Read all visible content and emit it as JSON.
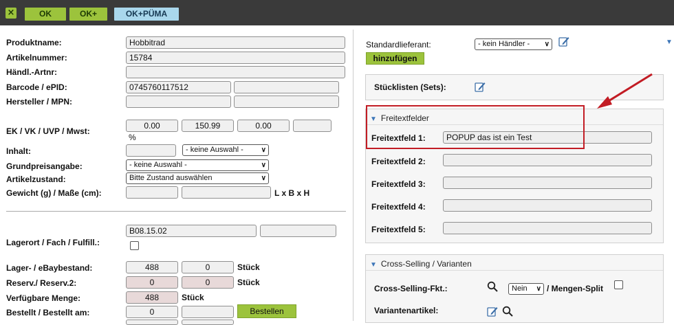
{
  "toolbar": {
    "close_icon": "×",
    "ok": "OK",
    "ok_plus": "OK+",
    "ok_puma": "OK+PÜMA"
  },
  "left": {
    "produktname": {
      "label": "Produktname:",
      "value": "Hobbitrad"
    },
    "artikelnummer": {
      "label": "Artikelnummer:",
      "value": "15784"
    },
    "haendl_artnr": {
      "label": "Händl.-Artnr:",
      "value": ""
    },
    "barcode": {
      "label": "Barcode / ePID:",
      "value": "0745760117512",
      "value2": ""
    },
    "hersteller": {
      "label": "Hersteller / MPN:",
      "value": "",
      "value2": ""
    },
    "ek_vk": {
      "label": "EK / VK / UVP / Mwst:",
      "ek": "0.00",
      "vk": "150.99",
      "uvp": "0.00",
      "mwst": "",
      "percent": "%"
    },
    "inhalt": {
      "label": "Inhalt:",
      "value": "",
      "select": "- keine Auswahl -"
    },
    "grundpreis": {
      "label": "Grundpreisangabe:",
      "select": "- keine Auswahl -"
    },
    "zustand": {
      "label": "Artikelzustand:",
      "select": "Bitte Zustand auswählen"
    },
    "gewicht": {
      "label": "Gewicht (g) / Maße (cm):",
      "value": "",
      "value2": "",
      "unit": "L x B x H"
    },
    "lagerort": {
      "label": "Lagerort / Fach / Fulfill.:",
      "value": "B08.15.02",
      "value2": ""
    },
    "lagerbestand": {
      "label": "Lager- / eBaybestand:",
      "value": "488",
      "value2": "0",
      "unit": "Stück"
    },
    "reserv": {
      "label": "Reserv./ Reserv.2:",
      "value": "0",
      "value2": "0",
      "unit": "Stück"
    },
    "verfuegbar": {
      "label": "Verfügbare Menge:",
      "value": "488",
      "unit": "Stück"
    },
    "bestellt": {
      "label": "Bestellt / Bestellt am:",
      "value": "0",
      "value2": "",
      "button": "Bestellen"
    }
  },
  "right": {
    "lieferant": {
      "label": "Standardlieferant:",
      "select": "- kein Händler -",
      "button": "hinzufügen"
    },
    "stuecklisten": {
      "label": "Stücklisten (Sets):"
    },
    "freitext": {
      "title": "Freitextfelder",
      "fields": [
        {
          "label": "Freitextfeld 1:",
          "value": "POPUP das ist ein Test"
        },
        {
          "label": "Freitextfeld 2:",
          "value": ""
        },
        {
          "label": "Freitextfeld 3:",
          "value": ""
        },
        {
          "label": "Freitextfeld 4:",
          "value": ""
        },
        {
          "label": "Freitextfeld 5:",
          "value": ""
        }
      ]
    },
    "cross": {
      "title": "Cross-Selling / Varianten",
      "fkt_label": "Cross-Selling-Fkt.:",
      "select": "Nein",
      "mengen_split": "/ Mengen-Split",
      "varianten_label": "Variantenartikel:"
    }
  },
  "colors": {
    "toolbar": "#3a3a3a",
    "accent_green": "#9cc33c",
    "accent_blue": "#a9d7ec",
    "highlight_red": "#c21c24"
  }
}
